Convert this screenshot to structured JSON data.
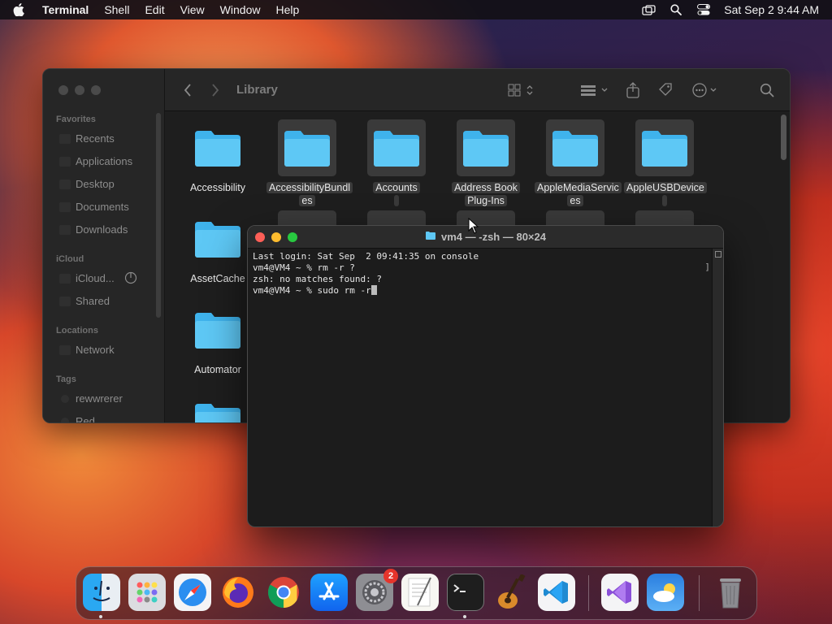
{
  "menubar": {
    "app_name": "Terminal",
    "menus": [
      "Shell",
      "Edit",
      "View",
      "Window",
      "Help"
    ],
    "clock": "Sat Sep 2  9:44 AM"
  },
  "finder": {
    "title": "Library",
    "sidebar": {
      "favorites_header": "Favorites",
      "favorites": [
        "Recents",
        "Applications",
        "Desktop",
        "Documents",
        "Downloads"
      ],
      "icloud_header": "iCloud",
      "icloud": [
        "iCloud...",
        "Shared"
      ],
      "locations_header": "Locations",
      "locations": [
        "Network"
      ],
      "tags_header": "Tags",
      "tags": [
        "rewwrerer",
        "Red"
      ]
    },
    "folders": [
      {
        "line1": "Accessibility",
        "line2": ""
      },
      {
        "line1": "AccessibilityBundl",
        "line2": "es"
      },
      {
        "line1": "Accounts",
        "line2": ""
      },
      {
        "line1": "Address Book",
        "line2": "Plug-Ins"
      },
      {
        "line1": "AppleMediaServic",
        "line2": "es"
      },
      {
        "line1": "AppleUSBDevice",
        "line2": ""
      },
      {
        "line1": "AssetCache",
        "line2": ""
      },
      {
        "line1": "Automator",
        "line2": ""
      }
    ]
  },
  "terminal": {
    "title": "vm4 — -zsh — 80×24",
    "lines": [
      "Last login: Sat Sep  2 09:41:35 on console",
      "vm4@VM4 ~ % rm -r ?",
      "zsh: no matches found: ?",
      "vm4@VM4 ~ % sudo rm -r"
    ]
  },
  "dock": {
    "apps": [
      "Finder",
      "Launchpad",
      "Safari",
      "Firefox",
      "Chrome",
      "App Store",
      "System Settings",
      "TextEdit",
      "Terminal",
      "GarageBand",
      "Visual Studio Code",
      "Visual Studio",
      "Weather",
      "Trash"
    ],
    "settings_badge": "2"
  },
  "colors": {
    "folder_blue": "#5ec8f5",
    "close": "#fe5f57",
    "minimize": "#febc2e",
    "zoom": "#28c840"
  }
}
